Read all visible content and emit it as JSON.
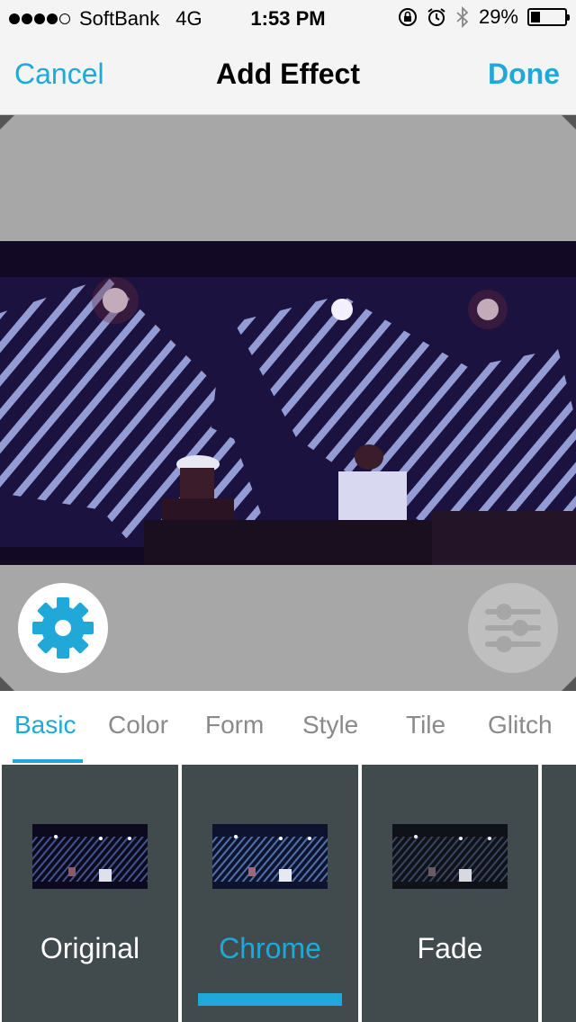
{
  "status_bar": {
    "carrier": "SoftBank",
    "network": "4G",
    "time": "1:53 PM",
    "battery": "29%",
    "battery_level": 0.29,
    "signal_bars": 4,
    "icons": [
      "rotation-lock-icon",
      "alarm-icon",
      "bluetooth-icon",
      "battery-icon"
    ]
  },
  "nav": {
    "cancel": "Cancel",
    "title": "Add Effect",
    "done": "Done"
  },
  "preview": {
    "settings_icon": "gear-icon",
    "adjust_icon": "sliders-icon"
  },
  "tabs": [
    {
      "label": "Basic",
      "active": true
    },
    {
      "label": "Color",
      "active": false
    },
    {
      "label": "Form",
      "active": false
    },
    {
      "label": "Style",
      "active": false
    },
    {
      "label": "Tile",
      "active": false
    },
    {
      "label": "Glitch",
      "active": false
    }
  ],
  "filters": [
    {
      "label": "Original",
      "selected": false
    },
    {
      "label": "Chrome",
      "selected": true
    },
    {
      "label": "Fade",
      "selected": false
    }
  ],
  "colors": {
    "accent": "#1fa8d8",
    "filter_bg": "#414a4c",
    "preview_bg": "#a7a7a7"
  }
}
